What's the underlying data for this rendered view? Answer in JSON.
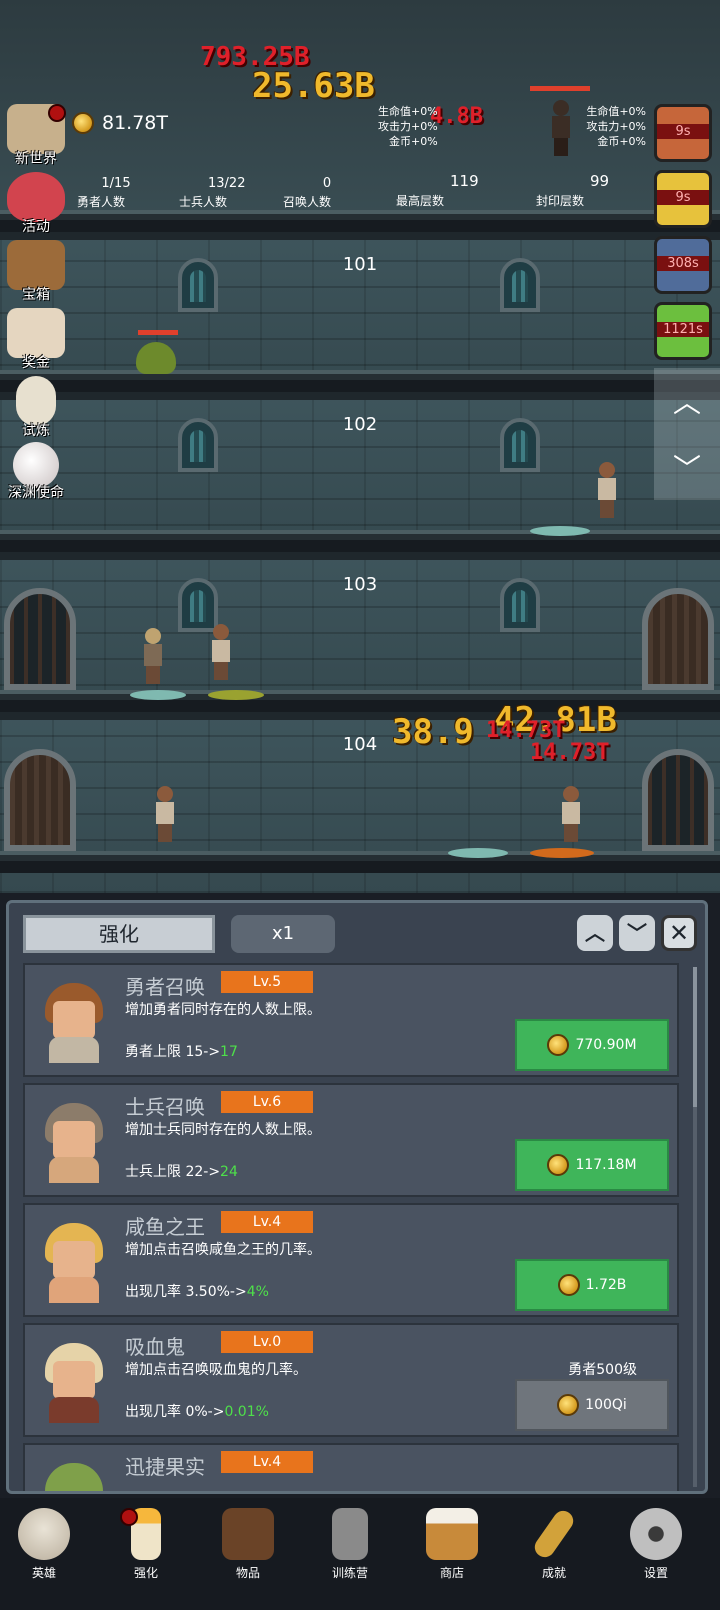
{
  "scene": {
    "floors": [
      "101",
      "102",
      "103",
      "104"
    ],
    "damage_numbers": [
      "793.25B",
      "25.63B",
      "4.8B",
      "42.81B",
      "38.9",
      "14.73T",
      "14.73T"
    ]
  },
  "top": {
    "coins": "81.78T",
    "stats": [
      {
        "value": "1/15",
        "label": "勇者人数"
      },
      {
        "value": "13/22",
        "label": "士兵人数"
      },
      {
        "value": "0",
        "label": "召唤人数"
      },
      {
        "value": "119",
        "label": "最高层数"
      },
      {
        "value": "99",
        "label": "封印层数"
      }
    ],
    "buffs_left": [
      "生命值+0%",
      "攻击力+0%",
      "金币+0%"
    ],
    "buffs_right": [
      "生命值+0%",
      "攻击力+0%",
      "金币+0%"
    ]
  },
  "side_menu": [
    "新世界",
    "活动",
    "宝箱",
    "奖金",
    "试炼",
    "深渊使命"
  ],
  "timers": [
    "9s",
    "9s",
    "308s",
    "1121s"
  ],
  "panel": {
    "tab": "强化",
    "multiplier": "x1",
    "cards": [
      {
        "name": "勇者召唤",
        "level": "Lv.5",
        "desc": "增加勇者同时存在的人数上限。",
        "upgrade_prefix": "勇者上限 15->",
        "upgrade_new": "17",
        "cost": "770.90M"
      },
      {
        "name": "士兵召唤",
        "level": "Lv.6",
        "desc": "增加士兵同时存在的人数上限。",
        "upgrade_prefix": "士兵上限 22->",
        "upgrade_new": "24",
        "cost": "117.18M"
      },
      {
        "name": "咸鱼之王",
        "level": "Lv.4",
        "desc": "增加点击召唤咸鱼之王的几率。",
        "upgrade_prefix": "出现几率 3.50%->",
        "upgrade_new": "4%",
        "cost": "1.72B"
      },
      {
        "name": "吸血鬼",
        "level": "Lv.0",
        "desc": "增加点击召唤吸血鬼的几率。",
        "upgrade_prefix": "出现几率 0%->",
        "upgrade_new": "0.01%",
        "requirement": "勇者500级",
        "cost": "100Qi"
      },
      {
        "name": "迅捷果实",
        "level": "Lv.4"
      }
    ]
  },
  "bottom_nav": [
    "英雄",
    "强化",
    "物品",
    "训练营",
    "商店",
    "成就",
    "设置"
  ],
  "colors": {
    "buy_green": "#3fb55a",
    "level_orange": "#e8741c",
    "upgrade_green": "#4ee04a"
  }
}
